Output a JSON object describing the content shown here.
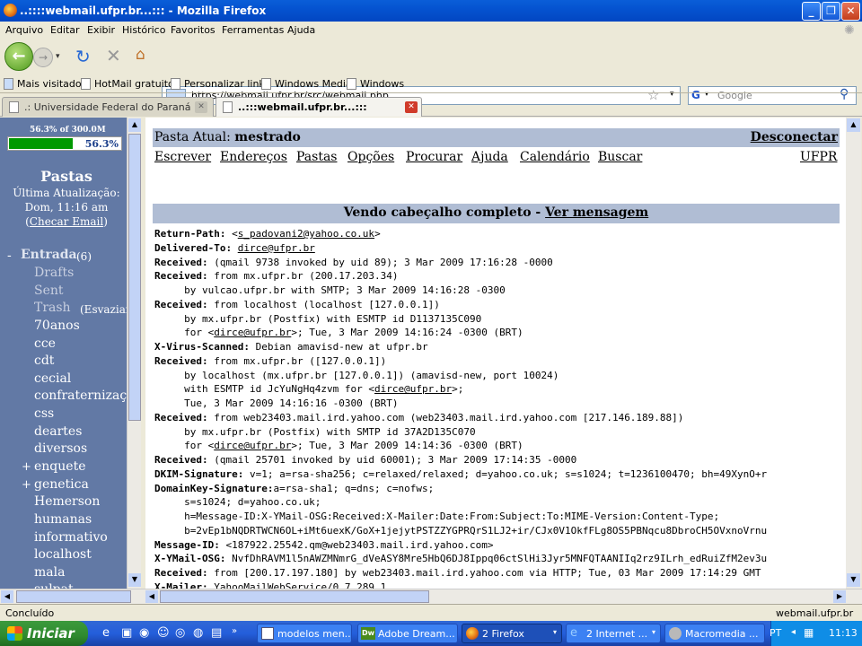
{
  "window": {
    "title": "..::::webmail.ufpr.br...::: - Mozilla Firefox"
  },
  "menu": [
    "Arquivo",
    "Editar",
    "Exibir",
    "Histórico",
    "Favoritos",
    "Ferramentas",
    "Ajuda"
  ],
  "navbar": {
    "url": "https://webmail.ufpr.br/src/webmail.php",
    "search_placeholder": "Google"
  },
  "bookmarks": [
    "Mais visitados",
    "HotMail gratuito",
    "Personalizar links",
    "Windows Media",
    "Windows"
  ],
  "tabs": [
    {
      "label": ".: Universidade Federal do Paraná :."
    },
    {
      "label": "..:::webmail.ufpr.br...:::"
    }
  ],
  "sidebar": {
    "quota_text": "56.3% of 300.0M",
    "quota_pct": "56.3%",
    "quota_fraction": 0.563,
    "folders_title": "Pastas",
    "last_update_label": "Última Atualização:",
    "last_update_time": "Dom, 11:16 am",
    "check_mail_open": "(",
    "check_mail": "Checar Email",
    "check_mail_close": ")",
    "inbox_prefix": "-",
    "inbox": "Entrada",
    "inbox_count": "(6)",
    "drafts": "Drafts",
    "sent": "Sent",
    "trash": "Trash",
    "trash_action": "(Esvaziar)",
    "plus1": "+",
    "plus2": "+",
    "folders": [
      "70anos",
      "cce",
      "cdt",
      "cecial",
      "confraternização",
      "css",
      "deartes",
      "diversos",
      "enquete",
      "genetica",
      "Hemerson",
      "humanas",
      "informativo",
      "localhost",
      "mala",
      "sulpat"
    ]
  },
  "main": {
    "current_folder_label": "Pasta Atual:",
    "current_folder": "mestrado",
    "logout": "Desconectar",
    "nav": [
      "Escrever",
      "Endereços",
      "Pastas",
      "Opções",
      "Procurar",
      "Ajuda",
      "Calendário",
      "Buscar"
    ],
    "ufpr": "UFPR",
    "header_title": "Vendo cabeçalho completo - ",
    "view_message": "Ver mensagem"
  },
  "headers": [
    {
      "k": "Return-Path:",
      "v": " <",
      "link": "s_padovani2@yahoo.co.uk",
      "after": ">"
    },
    {
      "k": "Delivered-To:",
      "v": " ",
      "link": "dirce@ufpr.br",
      "after": ""
    },
    {
      "k": "Received:",
      "v": " (qmail 9738 invoked by uid 89); 3 Mar 2009 17:16:28 -0000",
      "link": "",
      "after": ""
    },
    {
      "k": "Received:",
      "v": " from mx.ufpr.br (200.17.203.34)",
      "link": "",
      "after": ""
    },
    {
      "k": "",
      "v": "     by vulcao.ufpr.br with SMTP; 3 Mar 2009 14:16:28 -0300",
      "link": "",
      "after": ""
    },
    {
      "k": "Received:",
      "v": " from localhost (localhost [127.0.0.1])",
      "link": "",
      "after": ""
    },
    {
      "k": "",
      "v": "     by mx.ufpr.br (Postfix) with ESMTP id D1137135C090",
      "link": "",
      "after": ""
    },
    {
      "k": "",
      "v": "     for <",
      "link": "dirce@ufpr.br",
      "after": ">; Tue, 3 Mar 2009 14:16:24 -0300 (BRT)"
    },
    {
      "k": "X-Virus-Scanned:",
      "v": " Debian amavisd-new at ufpr.br",
      "link": "",
      "after": ""
    },
    {
      "k": "Received:",
      "v": " from mx.ufpr.br ([127.0.0.1])",
      "link": "",
      "after": ""
    },
    {
      "k": "",
      "v": "     by localhost (mx.ufpr.br [127.0.0.1]) (amavisd-new, port 10024)",
      "link": "",
      "after": ""
    },
    {
      "k": "",
      "v": "     with ESMTP id JcYuNgHq4zvm for <",
      "link": "dirce@ufpr.br",
      "after": ">;"
    },
    {
      "k": "",
      "v": "     Tue, 3 Mar 2009 14:16:16 -0300 (BRT)",
      "link": "",
      "after": ""
    },
    {
      "k": "Received:",
      "v": " from web23403.mail.ird.yahoo.com (web23403.mail.ird.yahoo.com [217.146.189.88])",
      "link": "",
      "after": ""
    },
    {
      "k": "",
      "v": "     by mx.ufpr.br (Postfix) with SMTP id 37A2D135C070",
      "link": "",
      "after": ""
    },
    {
      "k": "",
      "v": "     for <",
      "link": "dirce@ufpr.br",
      "after": ">; Tue, 3 Mar 2009 14:14:36 -0300 (BRT)"
    },
    {
      "k": "Received:",
      "v": " (qmail 25701 invoked by uid 60001); 3 Mar 2009 17:14:35 -0000",
      "link": "",
      "after": ""
    },
    {
      "k": "DKIM-Signature:",
      "v": " v=1; a=rsa-sha256; c=relaxed/relaxed; d=yahoo.co.uk; s=s1024; t=1236100470; bh=49XynO+r",
      "link": "",
      "after": ""
    },
    {
      "k": "DomainKey-Signature:",
      "v": "a=rsa-sha1; q=dns; c=nofws;",
      "link": "",
      "after": ""
    },
    {
      "k": "",
      "v": "     s=s1024; d=yahoo.co.uk;",
      "link": "",
      "after": ""
    },
    {
      "k": "",
      "v": "     h=Message-ID:X-YMail-OSG:Received:X-Mailer:Date:From:Subject:To:MIME-Version:Content-Type;",
      "link": "",
      "after": ""
    },
    {
      "k": "",
      "v": "     b=2vEp1bNQDRTWCN6OL+iMt6uexK/GoX+1jejytPSTZZYGPRQrS1LJ2+ir/CJx0V1OkfFLg8OS5PBNqcu8DbroCH5OVxnoVrnu",
      "link": "",
      "after": ""
    },
    {
      "k": "Message-ID:",
      "v": " <187922.25542.qm@web23403.mail.ird.yahoo.com>",
      "link": "",
      "after": ""
    },
    {
      "k": "X-YMail-OSG:",
      "v": " NvfDhRAVM1l5nAWZMNmrG_dVeASY8Mre5HbQ6DJ8Ippq06ctSlHi3Jyr5MNFQTAANIIq2rz9ILrh_edRuiZfM2ev3u",
      "link": "",
      "after": ""
    },
    {
      "k": "Received:",
      "v": " from [200.17.197.180] by web23403.mail.ird.yahoo.com via HTTP; Tue, 03 Mar 2009 17:14:29 GMT",
      "link": "",
      "after": ""
    },
    {
      "k": "X-Mailer:",
      "v": " YahooMailWebService/0.7.289.1",
      "link": "",
      "after": ""
    }
  ],
  "status": {
    "left": "Concluído",
    "right": "webmail.ufpr.br"
  },
  "taskbar": {
    "start": "Iniciar",
    "items": [
      "modelos men...",
      "Adobe Dream...",
      "2 Firefox",
      "2 Internet ...",
      "Macromedia ..."
    ],
    "lang": "PT",
    "clock": "11:13"
  }
}
